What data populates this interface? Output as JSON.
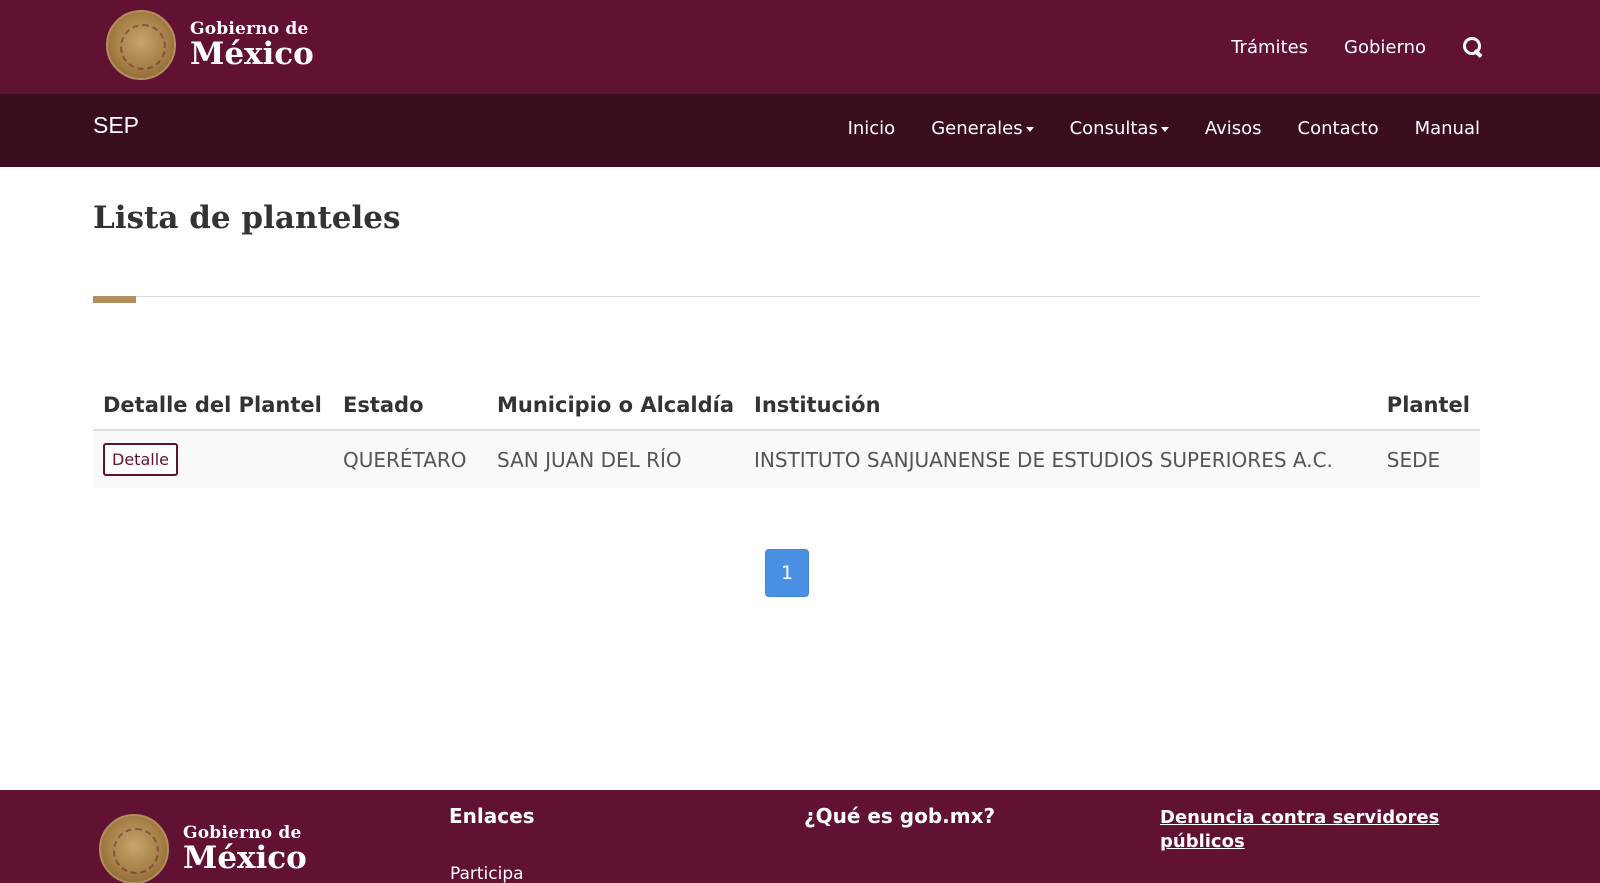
{
  "header": {
    "logo_line1": "Gobierno de",
    "logo_line2": "México",
    "links": [
      "Trámites",
      "Gobierno"
    ]
  },
  "subnav": {
    "brand": "SEP",
    "items": [
      {
        "label": "Inicio",
        "dropdown": false
      },
      {
        "label": "Generales",
        "dropdown": true
      },
      {
        "label": "Consultas",
        "dropdown": true
      },
      {
        "label": "Avisos",
        "dropdown": false
      },
      {
        "label": "Contacto",
        "dropdown": false
      },
      {
        "label": "Manual",
        "dropdown": false
      }
    ]
  },
  "main": {
    "title": "Lista de planteles",
    "table": {
      "columns": [
        "Detalle del Plantel",
        "Estado",
        "Municipio o Alcaldía",
        "Institución",
        "Plantel"
      ],
      "rows": [
        {
          "detail_label": "Detalle",
          "estado": "QUERÉTARO",
          "municipio": "SAN JUAN DEL RÍO",
          "institucion": "INSTITUTO SANJUANENSE DE ESTUDIOS SUPERIORES A.C.",
          "plantel": "SEDE"
        }
      ]
    },
    "pagination": {
      "current": "1"
    }
  },
  "footer": {
    "logo_line1": "Gobierno de",
    "logo_line2": "México",
    "enlaces_title": "Enlaces",
    "enlaces_first": "Participa",
    "que_es_title": "¿Qué es gob.mx?",
    "denuncia": "Denuncia contra servidores públicos"
  },
  "colors": {
    "primary": "#611232",
    "dark": "#3a0d20",
    "gold": "#b38e5d",
    "pagination": "#4a90e2"
  }
}
